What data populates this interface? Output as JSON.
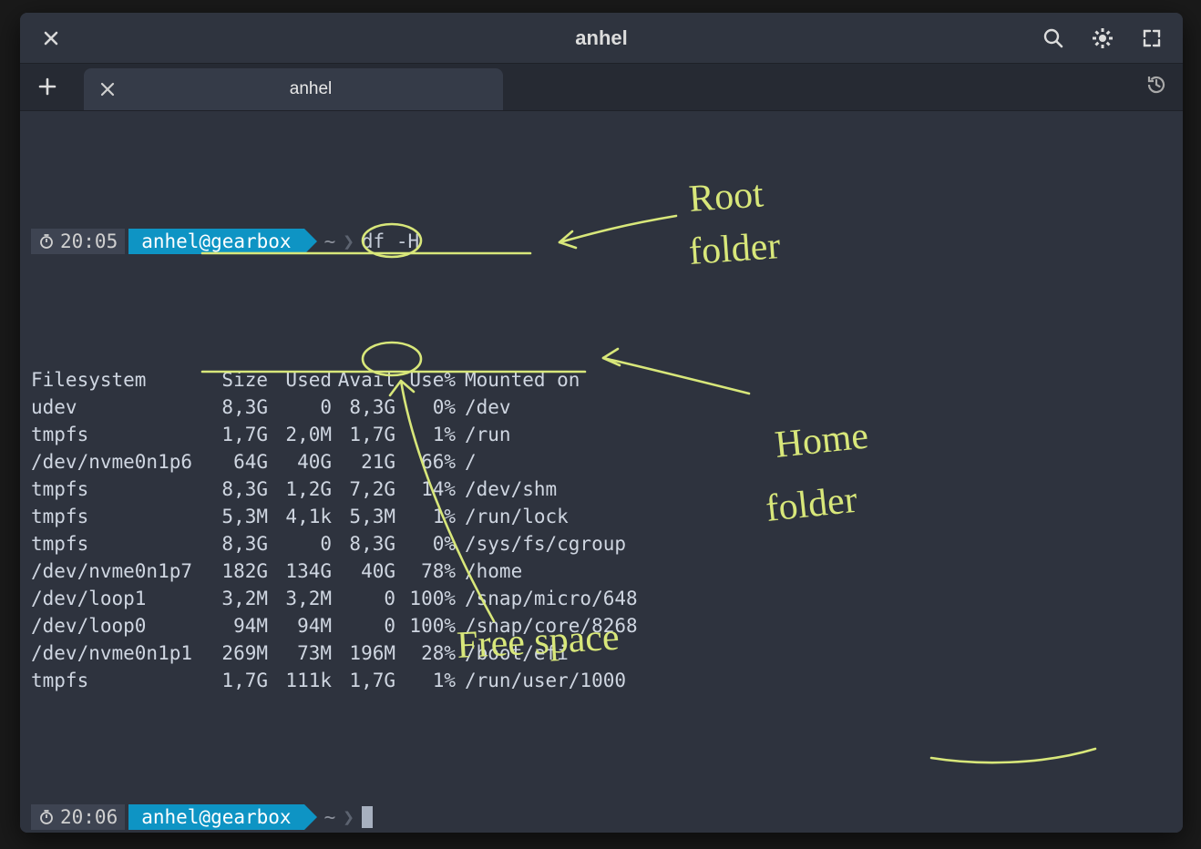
{
  "window": {
    "title": "anhel"
  },
  "tab": {
    "title": "anhel"
  },
  "prompt1": {
    "time": "20:05",
    "userhost": "anhel@gearbox",
    "path": "~",
    "command": "df -H"
  },
  "prompt2": {
    "time": "20:06",
    "userhost": "anhel@gearbox",
    "path": "~"
  },
  "df": {
    "headers": {
      "fs": "Filesystem",
      "size": "Size",
      "used": "Used",
      "avail": "Avail",
      "use": "Use%",
      "mnt": "Mounted on"
    },
    "rows": [
      {
        "fs": "udev",
        "size": "8,3G",
        "used": "0",
        "avail": "8,3G",
        "use": "0%",
        "mnt": "/dev"
      },
      {
        "fs": "tmpfs",
        "size": "1,7G",
        "used": "2,0M",
        "avail": "1,7G",
        "use": "1%",
        "mnt": "/run"
      },
      {
        "fs": "/dev/nvme0n1p6",
        "size": "64G",
        "used": "40G",
        "avail": "21G",
        "use": "66%",
        "mnt": "/"
      },
      {
        "fs": "tmpfs",
        "size": "8,3G",
        "used": "1,2G",
        "avail": "7,2G",
        "use": "14%",
        "mnt": "/dev/shm"
      },
      {
        "fs": "tmpfs",
        "size": "5,3M",
        "used": "4,1k",
        "avail": "5,3M",
        "use": "1%",
        "mnt": "/run/lock"
      },
      {
        "fs": "tmpfs",
        "size": "8,3G",
        "used": "0",
        "avail": "8,3G",
        "use": "0%",
        "mnt": "/sys/fs/cgroup"
      },
      {
        "fs": "/dev/nvme0n1p7",
        "size": "182G",
        "used": "134G",
        "avail": "40G",
        "use": "78%",
        "mnt": "/home"
      },
      {
        "fs": "/dev/loop1",
        "size": "3,2M",
        "used": "3,2M",
        "avail": "0",
        "use": "100%",
        "mnt": "/snap/micro/648"
      },
      {
        "fs": "/dev/loop0",
        "size": "94M",
        "used": "94M",
        "avail": "0",
        "use": "100%",
        "mnt": "/snap/core/8268"
      },
      {
        "fs": "/dev/nvme0n1p1",
        "size": "269M",
        "used": "73M",
        "avail": "196M",
        "use": "28%",
        "mnt": "/boot/efi"
      },
      {
        "fs": "tmpfs",
        "size": "1,7G",
        "used": "111k",
        "avail": "1,7G",
        "use": "1%",
        "mnt": "/run/user/1000"
      }
    ]
  },
  "annotations": {
    "root": "Root folder",
    "home": "Home folder",
    "free": "Free space"
  },
  "colors": {
    "accent": "#0e94c4",
    "ink": "#d8e77a"
  }
}
